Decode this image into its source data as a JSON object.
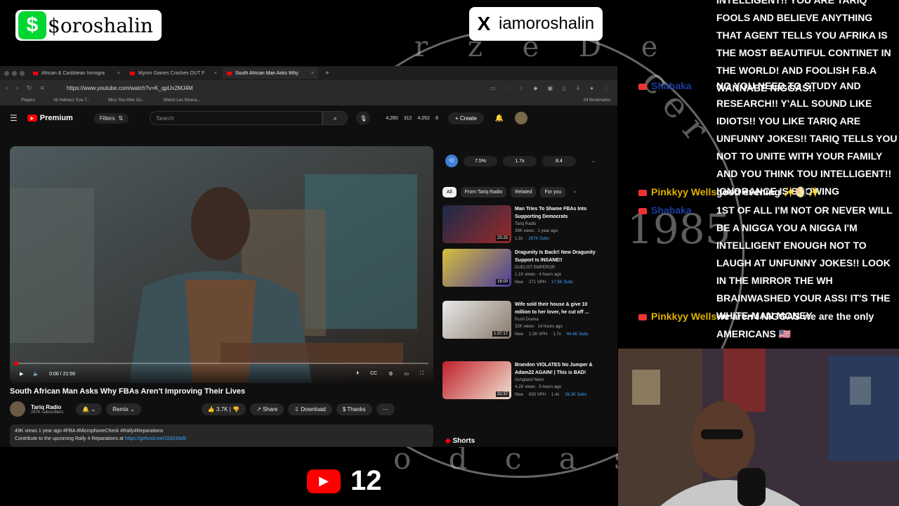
{
  "overlay": {
    "cashtag": "$oroshalin",
    "x_handle": "iamoroshalin",
    "circle_top_text": "r z e D e",
    "circle_right_text": "c e r",
    "circle_year": "1985",
    "circle_bottom_text": "o d c a s",
    "youtube_count": "12"
  },
  "browser": {
    "tabs": [
      {
        "label": "African & Caribbean Immigra"
      },
      {
        "label": "Myron Gaines Crashes OUT F"
      },
      {
        "label": "South African Man Asks Why"
      }
    ],
    "url": "https://www.youtube.com/watch?v=K_qpUx2MJ4M",
    "bookmarks": [
      "Players",
      "All Hallows' Eve T...",
      "Miss You After Go...",
      "Watch Les Misera..."
    ],
    "all_bookmarks": "All Bookmarks"
  },
  "youtube": {
    "logo": "Premium",
    "filters": "Filters",
    "search_placeholder": "Search",
    "stats": [
      "4,280",
      "312",
      "4,052",
      "8"
    ],
    "create": "Create",
    "player": {
      "time": "0:00 / 21:56"
    },
    "video_title": "South African Man Asks Why FBAs Aren't Improving Their Lives",
    "channel": "Tariq Radio",
    "subscribers": "267K subscribers",
    "remix": "Remix",
    "likes": "3.7K",
    "share": "Share",
    "download": "Download",
    "thanks": "Thanks",
    "description_line1": "49K views  1 year ago  #FBA #MicrophoneCheck #Rally4Reparations",
    "description_line2": "Contribute to the upcoming Rally 4 Reparations at ",
    "description_link": "https://gofund.me/153233d9",
    "iq_values": [
      "7.5%",
      "1.7x",
      "8.4"
    ],
    "chips": [
      "All",
      "From Tariq Radio",
      "Related",
      "For you"
    ],
    "recommendations": [
      {
        "title": "Man Tries To Shame FBAs Into Supporting Democrats",
        "channel": "Tariq Radio",
        "meta": "39K views · 1 year ago",
        "duration": "25:25",
        "tags": [
          "1.3x",
          "267K Subs"
        ]
      },
      {
        "title": "Dragunity Is Back!! New Dragunity Support Is INSANE!!",
        "channel": "DUELIST EMPEROR",
        "meta": "1.1K views · 4 hours ago",
        "duration": "16:00",
        "tags": [
          "New",
          "271 VPH",
          "17.5K Subs"
        ]
      },
      {
        "title": "Wife sold their house & give 10 million to her lover, he cut off ...",
        "channel": "Rush Drama",
        "meta": "32K views · 14 hours ago",
        "duration": "1:37:17",
        "tags": [
          "New",
          "2.3K VPH",
          "1.7x",
          "44.4K Subs"
        ]
      },
      {
        "title": "Brandon VIOLATES No Jumper & Adam22 AGAIN! | This is BAD!",
        "channel": "Gvngland Niem",
        "meta": "4.2K views · 5 hours ago",
        "duration": "31:37",
        "tags": [
          "New",
          "830 VPH",
          "1.4x",
          "26.2K Subs"
        ]
      }
    ],
    "shorts": "Shorts"
  },
  "chat": [
    {
      "user": "",
      "text": "INTELLIGENT!! YOU ARE TARIQ FOOLS AND BELIEVE ANYTHING THAT AGENT TELLS YOU AFRIKA IS THE MOST BEAUTIFUL CONTINET IN THE WORLD! AND FOOLISH F.B.A WANNABE NIGGAS!!"
    },
    {
      "user": "Shabaka",
      "text": "NO YOU NEED TO STUDY AND RESEARCH!! Y'ALL SOUND LIKE IDIOTS!! YOU LIKE TARIQ ARE UNFUNNY JOKES!! TARIQ TELLS YOU NOT TO UNITE WITH YOUR FAMILY AND YOU THINK TOU INTELLIGENT!! IGNORANCE IS SHOWING"
    },
    {
      "user": "Pinkkyy Wells",
      "text": "good evening ✨🌖✨"
    },
    {
      "user": "Shabaka",
      "text": "1ST OF ALL I'M NOT OR NEVER WILL BE A NIGGA YOU A NIGGA I'M INTELLIGENT ENOUGH NOT TO LAUGH AT UNFUNNY JOKES!! LOOK IN THE MIRROR THE WH BRAINWASHED YOUR ASS! IT'S THE WHITE-MAN MONEY"
    },
    {
      "user": "Pinkkyy Wells",
      "text": "we aren't NIGGAS we are the only AMERICANS 🇺🇸"
    }
  ]
}
